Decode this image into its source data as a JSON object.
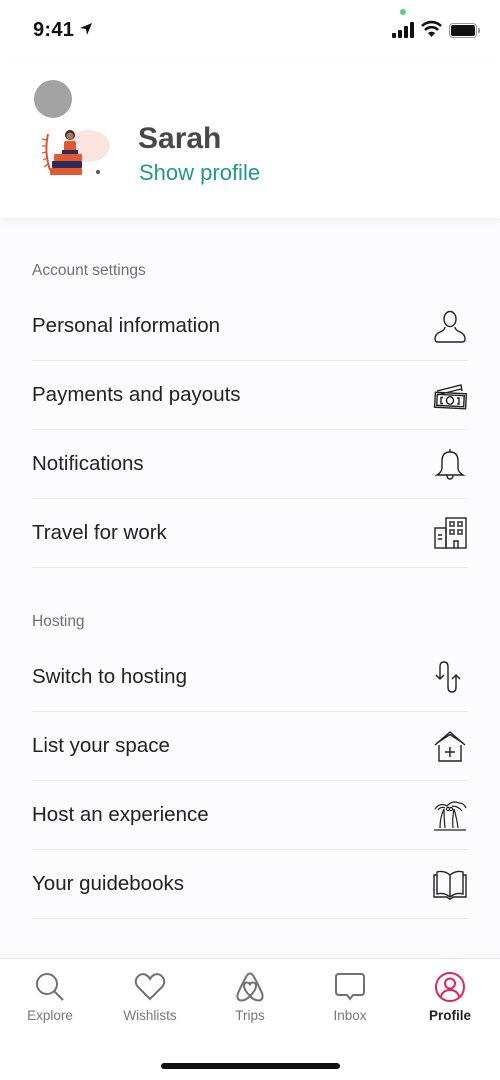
{
  "status_bar": {
    "time": "9:41",
    "icons": [
      "location-arrow-icon",
      "signal-icon",
      "wifi-icon",
      "battery-icon"
    ]
  },
  "profile": {
    "name": "Sarah",
    "show_profile_label": "Show profile",
    "illustration": "person-reading-on-books-illustration"
  },
  "sections": [
    {
      "header": "Account settings",
      "items": [
        {
          "label": "Personal information",
          "icon": "person-icon"
        },
        {
          "label": "Payments and payouts",
          "icon": "money-card-icon"
        },
        {
          "label": "Notifications",
          "icon": "bell-icon"
        },
        {
          "label": "Travel for work",
          "icon": "building-icon"
        }
      ]
    },
    {
      "header": "Hosting",
      "items": [
        {
          "label": "Switch to hosting",
          "icon": "switch-arrows-icon"
        },
        {
          "label": "List your space",
          "icon": "house-plus-icon"
        },
        {
          "label": "Host an experience",
          "icon": "palm-trees-icon"
        },
        {
          "label": "Your guidebooks",
          "icon": "book-icon"
        }
      ]
    }
  ],
  "tab_bar": {
    "active": "Profile",
    "active_color": "#e0245e",
    "tabs": [
      {
        "label": "Explore",
        "icon": "search-icon"
      },
      {
        "label": "Wishlists",
        "icon": "heart-icon"
      },
      {
        "label": "Trips",
        "icon": "airbnb-logo-icon"
      },
      {
        "label": "Inbox",
        "icon": "chat-bubble-icon"
      },
      {
        "label": "Profile",
        "icon": "profile-circle-icon"
      }
    ]
  },
  "colors": {
    "accent_teal": "#1f9a86",
    "accent_pink": "#e0245e"
  }
}
